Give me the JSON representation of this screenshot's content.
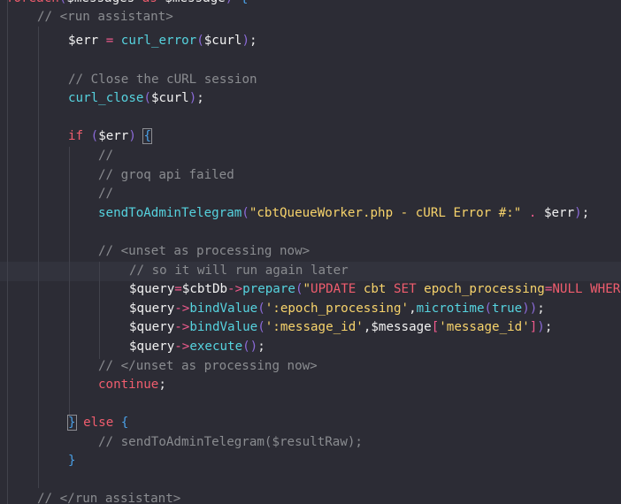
{
  "lines": [
    {
      "id": "l0",
      "tokens": [
        [
          "foreach",
          "t-kw"
        ],
        [
          "(",
          "t-paren"
        ],
        [
          "$messages",
          "t-var"
        ],
        [
          " as ",
          "t-kw"
        ],
        [
          "$message",
          "t-var"
        ],
        [
          ")",
          "t-paren"
        ],
        [
          " {",
          "t-brace"
        ]
      ]
    },
    {
      "id": "l1",
      "tokens": [
        [
          "// <run assistant>",
          "t-comment"
        ]
      ]
    },
    {
      "id": "l2",
      "tokens": [
        [
          "$err",
          "t-var"
        ],
        [
          " = ",
          "t-op"
        ],
        [
          "curl_error",
          "t-fn"
        ],
        [
          "(",
          "t-paren"
        ],
        [
          "$curl",
          "t-var"
        ],
        [
          ")",
          "t-paren"
        ],
        [
          ";",
          "t-white"
        ]
      ]
    },
    {
      "id": "l3",
      "tokens": [
        [
          "// Close the cURL session",
          "t-comment"
        ]
      ]
    },
    {
      "id": "l4",
      "tokens": [
        [
          "curl_close",
          "t-fn"
        ],
        [
          "(",
          "t-paren"
        ],
        [
          "$curl",
          "t-var"
        ],
        [
          ")",
          "t-paren"
        ],
        [
          ";",
          "t-white"
        ]
      ]
    },
    {
      "id": "l5",
      "tokens": [
        [
          "if",
          "t-kw"
        ],
        [
          " (",
          "t-paren"
        ],
        [
          "$err",
          "t-var"
        ],
        [
          ")",
          "t-paren"
        ],
        [
          " ",
          "t-white"
        ],
        [
          "{",
          "t-brace"
        ]
      ]
    },
    {
      "id": "l6",
      "tokens": [
        [
          "//",
          "t-comment"
        ]
      ]
    },
    {
      "id": "l7",
      "tokens": [
        [
          "// groq api failed",
          "t-comment"
        ]
      ]
    },
    {
      "id": "l8",
      "tokens": [
        [
          "//",
          "t-comment"
        ]
      ]
    },
    {
      "id": "l9",
      "tokens": [
        [
          "sendToAdminTelegram",
          "t-fn"
        ],
        [
          "(",
          "t-paren"
        ],
        [
          "\"cbtQueueWorker.php - cURL Error #:\"",
          "t-str"
        ],
        [
          " . ",
          "t-op"
        ],
        [
          "$err",
          "t-var"
        ],
        [
          ")",
          "t-paren"
        ],
        [
          ";",
          "t-white"
        ]
      ]
    },
    {
      "id": "l10",
      "tokens": [
        [
          "// <unset as processing now>",
          "t-comment"
        ]
      ]
    },
    {
      "id": "l11",
      "tokens": [
        [
          "// so it will run again later",
          "t-comment"
        ]
      ]
    },
    {
      "id": "l12",
      "tokens": [
        [
          "$query",
          "t-var"
        ],
        [
          "=",
          "t-op"
        ],
        [
          "$cbtDb",
          "t-var"
        ],
        [
          "->",
          "t-op"
        ],
        [
          "prepare",
          "t-fn"
        ],
        [
          "(",
          "t-paren"
        ],
        [
          "\"",
          "t-str"
        ],
        [
          "UPDATE",
          "t-sql"
        ],
        [
          " cbt ",
          "t-str"
        ],
        [
          "SET",
          "t-sql"
        ],
        [
          " epoch_processing",
          "t-str"
        ],
        [
          "=",
          "t-op"
        ],
        [
          "NULL",
          "t-sql"
        ],
        [
          " ",
          "t-str"
        ],
        [
          "WHERE",
          "t-sql"
        ]
      ]
    },
    {
      "id": "l13",
      "tokens": [
        [
          "$query",
          "t-var"
        ],
        [
          "->",
          "t-op"
        ],
        [
          "bindValue",
          "t-fn"
        ],
        [
          "(",
          "t-paren"
        ],
        [
          "':epoch_processing'",
          "t-str"
        ],
        [
          ",",
          "t-white"
        ],
        [
          "microtime",
          "t-fn"
        ],
        [
          "(",
          "t-paren"
        ],
        [
          "true",
          "t-const"
        ],
        [
          "))",
          "t-paren"
        ],
        [
          ";",
          "t-white"
        ]
      ]
    },
    {
      "id": "l14",
      "tokens": [
        [
          "$query",
          "t-var"
        ],
        [
          "->",
          "t-op"
        ],
        [
          "bindValue",
          "t-fn"
        ],
        [
          "(",
          "t-paren"
        ],
        [
          "':message_id'",
          "t-str"
        ],
        [
          ",",
          "t-white"
        ],
        [
          "$message",
          "t-var"
        ],
        [
          "[",
          "t-op"
        ],
        [
          "'message_id'",
          "t-str"
        ],
        [
          "]",
          "t-op"
        ],
        [
          ")",
          "t-paren"
        ],
        [
          ";",
          "t-white"
        ]
      ]
    },
    {
      "id": "l15",
      "tokens": [
        [
          "$query",
          "t-var"
        ],
        [
          "->",
          "t-op"
        ],
        [
          "execute",
          "t-fn"
        ],
        [
          "()",
          "t-paren"
        ],
        [
          ";",
          "t-white"
        ]
      ]
    },
    {
      "id": "l16",
      "tokens": [
        [
          "// </unset as processing now>",
          "t-comment"
        ]
      ]
    },
    {
      "id": "l17",
      "tokens": [
        [
          "continue",
          "t-kw"
        ],
        [
          ";",
          "t-white"
        ]
      ]
    },
    {
      "id": "l18",
      "tokens": [
        [
          "}",
          "t-brace"
        ],
        [
          " else ",
          "t-kw"
        ],
        [
          "{",
          "t-brace"
        ]
      ]
    },
    {
      "id": "l19",
      "tokens": [
        [
          "// sendToAdminTelegram($resultRaw);",
          "t-comment"
        ]
      ]
    },
    {
      "id": "l20",
      "tokens": [
        [
          "}",
          "t-brace"
        ]
      ]
    },
    {
      "id": "l21",
      "tokens": [
        [
          "// </run assistant>",
          "t-comment"
        ]
      ]
    }
  ],
  "colors": {
    "background": "#2c2c35",
    "comment": "#8a8c90",
    "function": "#56d3df",
    "keyword": "#f05d6e",
    "string": "#f7d36b",
    "paren": "#8b6ad8",
    "brace": "#4aa0e6"
  }
}
